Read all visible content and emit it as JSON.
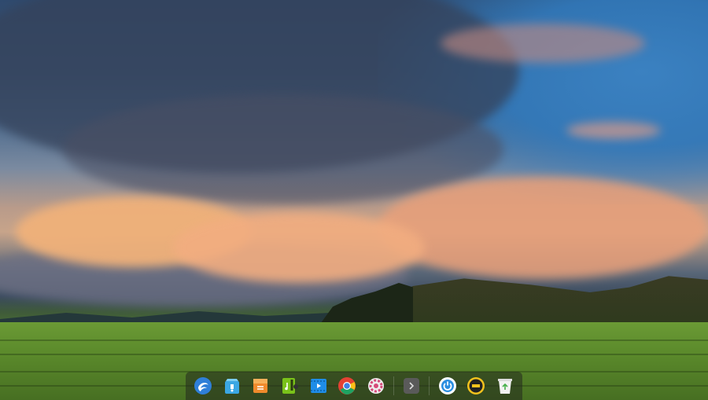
{
  "desktop": {
    "wallpaper": "sunset-clouds-over-grassland"
  },
  "dock": {
    "colors": {
      "background": "rgba(35,40,30,0.55)"
    },
    "items": [
      {
        "icon": "launcher-icon",
        "accent": "#2f7fd8"
      },
      {
        "icon": "app-store-icon",
        "accent": "#3ba7e3"
      },
      {
        "icon": "file-manager-icon",
        "accent": "#f08a2c"
      },
      {
        "icon": "music-player-icon",
        "accent": "#7ac21a"
      },
      {
        "icon": "video-player-icon",
        "accent": "#1f8de8"
      },
      {
        "icon": "chrome-browser-icon",
        "accent": "#e34133"
      },
      {
        "icon": "settings-icon",
        "accent": "#d64a7a"
      },
      {
        "icon": "show-more-icon",
        "accent": "#6a6a6a"
      },
      {
        "icon": "power-icon",
        "accent": "#2a8ee0"
      },
      {
        "icon": "clock-icon",
        "accent": "#f3c21d"
      },
      {
        "icon": "trash-icon",
        "accent": "#e9e9e9"
      }
    ]
  }
}
